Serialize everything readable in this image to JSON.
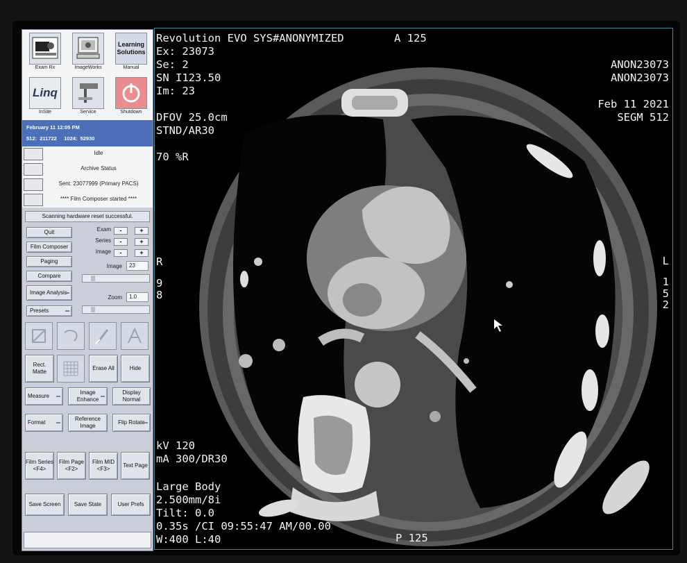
{
  "apps": [
    {
      "label": "Exam Rx",
      "icon": "exam-rx-icon"
    },
    {
      "label": "ImageWorks",
      "icon": "imageworks-icon"
    },
    {
      "label": "Manual",
      "icon": "learning-solutions-icon",
      "tile_text": "Learning Solutions"
    },
    {
      "label": "InSite",
      "icon": "linq-icon",
      "tile_text": "Linq"
    },
    {
      "label": "Service",
      "icon": "service-icon"
    },
    {
      "label": "Shutdown",
      "icon": "shutdown-icon"
    }
  ],
  "info": {
    "datetime": "February 11  12:05 PM",
    "k512_label": "512:",
    "k512_value": "211722",
    "k1024_label": "1024:",
    "k1024_value": "52930"
  },
  "status": {
    "idle": "Idle",
    "archive": "Archive Status",
    "sent": "Sent: 23077999 (Primary PACS)",
    "film": "**** Film Composer started ****"
  },
  "message": "Scanning hardware reset successful.",
  "controls": {
    "quit": "Quit",
    "film_composer": "Film Composer",
    "paging": "Paging",
    "compare": "Compare",
    "image_analysis": "Image Analysis",
    "presets": "Presets",
    "exam": "Exam",
    "series": "Series",
    "image": "Image",
    "image_field_label": "Image",
    "image_value": "23",
    "zoom_label": "Zoom",
    "zoom_value": "1.0",
    "minus": "-",
    "plus": "+"
  },
  "tools": {
    "rect_matte": "Rect. Matte",
    "erase_all": "Erase All",
    "hide": "Hide",
    "measure": "Measure",
    "image_enhance": "Image Enhance",
    "display_normal": "Display Normal",
    "format": "Format",
    "reference_image": "Reference Image",
    "flip_rotate": "Flip Rotate",
    "film_series": "Film Series <F4>",
    "film_page": "Film Page <F2>",
    "film_mid": "Film MID <F3>",
    "text_page": "Text Page",
    "save_screen": "Save Screen",
    "save_state": "Save State",
    "user_prefs": "User Prefs"
  },
  "overlay": {
    "system": "Revolution EVO SYS#ANONYMIZED",
    "anterior": "A 125",
    "exam": "Ex: 23073",
    "series": "Se: 2",
    "sn": "SN I123.50",
    "image": "Im: 23",
    "dfov": "DFOV 25.0cm",
    "stnd": "STND/AR30",
    "recon": "70 %R",
    "side_r": "R",
    "r_num1": "9",
    "r_num2": "8",
    "anon1": "ANON23073",
    "anon2": "ANON23073",
    "date": "Feb 11 2021",
    "segm": "SEGM 512",
    "side_l": "L",
    "l_num1": "1",
    "l_num2": "5",
    "l_num3": "2",
    "kv": "kV 120",
    "ma": "mA 300/DR30",
    "body": "Large Body",
    "thickness": "2.500mm/8i",
    "tilt": "Tilt: 0.0",
    "time": "0.35s /CI 09:55:47 AM/00.00",
    "window": "W:400 L:40",
    "posterior": "P 125"
  }
}
